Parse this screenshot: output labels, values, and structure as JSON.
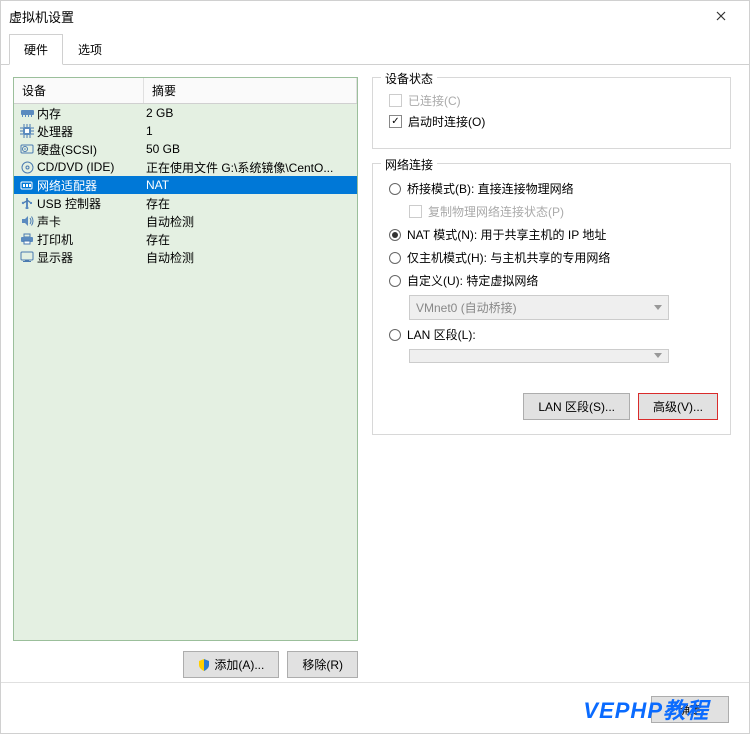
{
  "window": {
    "title": "虚拟机设置"
  },
  "tabs": {
    "hardware": "硬件",
    "options": "选项"
  },
  "table": {
    "col_device": "设备",
    "col_summary": "摘要",
    "rows": [
      {
        "icon": "memory",
        "name": "内存",
        "summary": "2 GB"
      },
      {
        "icon": "cpu",
        "name": "处理器",
        "summary": "1"
      },
      {
        "icon": "hdd",
        "name": "硬盘(SCSI)",
        "summary": "50 GB"
      },
      {
        "icon": "cd",
        "name": "CD/DVD (IDE)",
        "summary": "正在使用文件 G:\\系统镜像\\CentO..."
      },
      {
        "icon": "net",
        "name": "网络适配器",
        "summary": "NAT",
        "selected": true
      },
      {
        "icon": "usb",
        "name": "USB 控制器",
        "summary": "存在"
      },
      {
        "icon": "sound",
        "name": "声卡",
        "summary": "自动检测"
      },
      {
        "icon": "printer",
        "name": "打印机",
        "summary": "存在"
      },
      {
        "icon": "display",
        "name": "显示器",
        "summary": "自动检测"
      }
    ]
  },
  "left_buttons": {
    "add": "添加(A)...",
    "remove": "移除(R)"
  },
  "device_status": {
    "legend": "设备状态",
    "connected": "已连接(C)",
    "connect_at_poweron": "启动时连接(O)"
  },
  "network": {
    "legend": "网络连接",
    "bridged": "桥接模式(B): 直接连接物理网络",
    "bridged_sub": "复制物理网络连接状态(P)",
    "nat": "NAT 模式(N): 用于共享主机的 IP 地址",
    "hostonly": "仅主机模式(H): 与主机共享的专用网络",
    "custom": "自定义(U): 特定虚拟网络",
    "custom_select": "VMnet0 (自动桥接)",
    "lan": "LAN 区段(L):",
    "lan_segments_btn": "LAN 区段(S)...",
    "advanced_btn": "高级(V)..."
  },
  "bottom": {
    "ok": "确定"
  },
  "watermark": "VEPHP教程"
}
